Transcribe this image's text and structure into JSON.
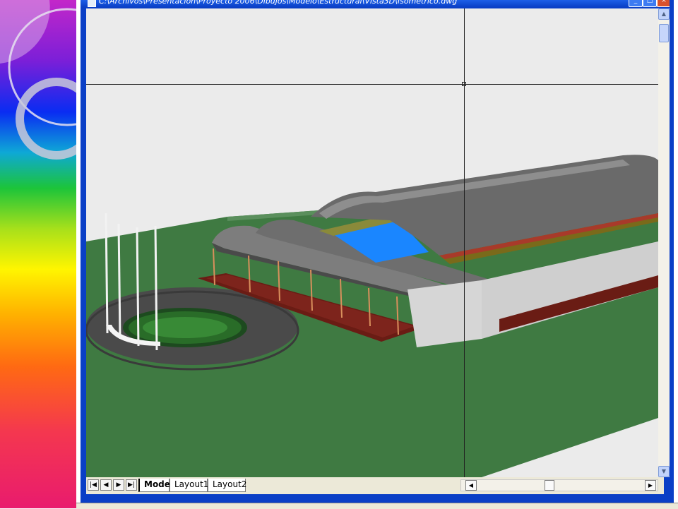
{
  "window": {
    "title": "C:\\Archivos\\Presentacion\\Proyecto 2006\\Dibujos\\Modelo\\Estructural\\Vista3D\\Isometrico.dwg",
    "minimize_label": "_",
    "maximize_label": "□",
    "close_label": "×"
  },
  "colors": {
    "titlebar": "#0a3fc6",
    "ground": "#3f7a42",
    "roof": "#6c6c6c",
    "pool": "#1a86ff",
    "walls": "#d4d4d4"
  },
  "layout_tabs": {
    "nav": [
      "|◀",
      "◀",
      "▶",
      "▶|"
    ],
    "tabs": [
      "Model",
      "Layout1",
      "Layout2"
    ],
    "active": "Model"
  },
  "scrollbars": {
    "up": "▲",
    "down": "▼",
    "left": "◀",
    "right": "▶"
  },
  "icons": {
    "crosshair": "crosshair-cursor-icon",
    "app": "autocad-app-icon"
  }
}
